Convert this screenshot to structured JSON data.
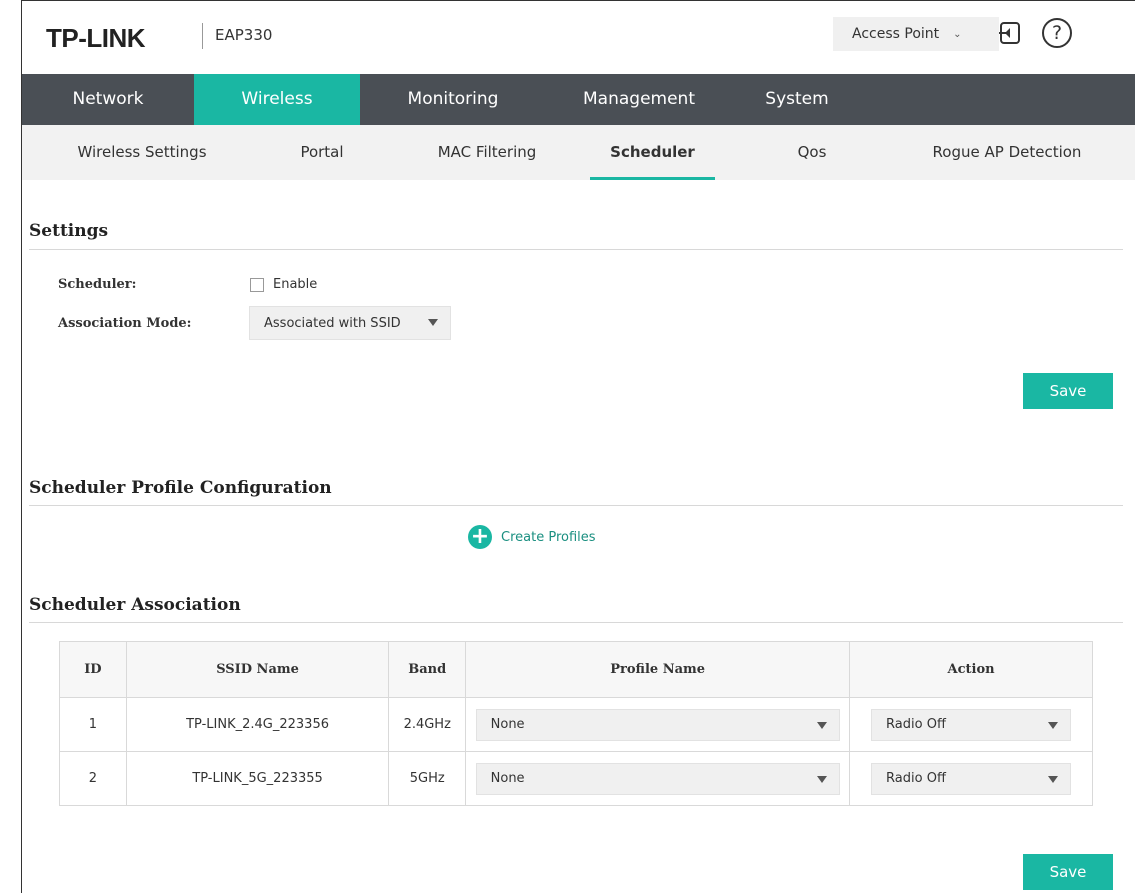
{
  "header": {
    "brand": "TP-LINK",
    "model": "EAP330",
    "mode_selector": {
      "value": "Access Point"
    },
    "icons": {
      "logout": "logout-icon",
      "help": "help-icon"
    }
  },
  "main_nav": [
    {
      "label": "Network",
      "active": false
    },
    {
      "label": "Wireless",
      "active": true
    },
    {
      "label": "Monitoring",
      "active": false
    },
    {
      "label": "Management",
      "active": false
    },
    {
      "label": "System",
      "active": false
    }
  ],
  "sub_nav": [
    {
      "label": "Wireless Settings",
      "active": false
    },
    {
      "label": "Portal",
      "active": false
    },
    {
      "label": "MAC Filtering",
      "active": false
    },
    {
      "label": "Scheduler",
      "active": true
    },
    {
      "label": "Qos",
      "active": false
    },
    {
      "label": "Rogue AP Detection",
      "active": false
    }
  ],
  "settings": {
    "title": "Settings",
    "scheduler_label": "Scheduler:",
    "enable_label": "Enable",
    "enable_checked": false,
    "association_mode_label": "Association Mode:",
    "association_mode_value": "Associated with SSID",
    "save_label": "Save"
  },
  "profile_config": {
    "title": "Scheduler Profile Configuration",
    "create_label": "Create Profiles"
  },
  "association": {
    "title": "Scheduler Association",
    "columns": [
      "ID",
      "SSID Name",
      "Band",
      "Profile Name",
      "Action"
    ],
    "rows": [
      {
        "id": "1",
        "ssid": "TP-LINK_2.4G_223356",
        "band": "2.4GHz",
        "profile": "None",
        "action": "Radio Off"
      },
      {
        "id": "2",
        "ssid": "TP-LINK_5G_223355",
        "band": "5GHz",
        "profile": "None",
        "action": "Radio Off"
      }
    ],
    "save_label": "Save"
  },
  "colors": {
    "accent": "#1ab7a3",
    "nav_bg": "#4a4f55",
    "subnav_bg": "#f2f2f2"
  }
}
